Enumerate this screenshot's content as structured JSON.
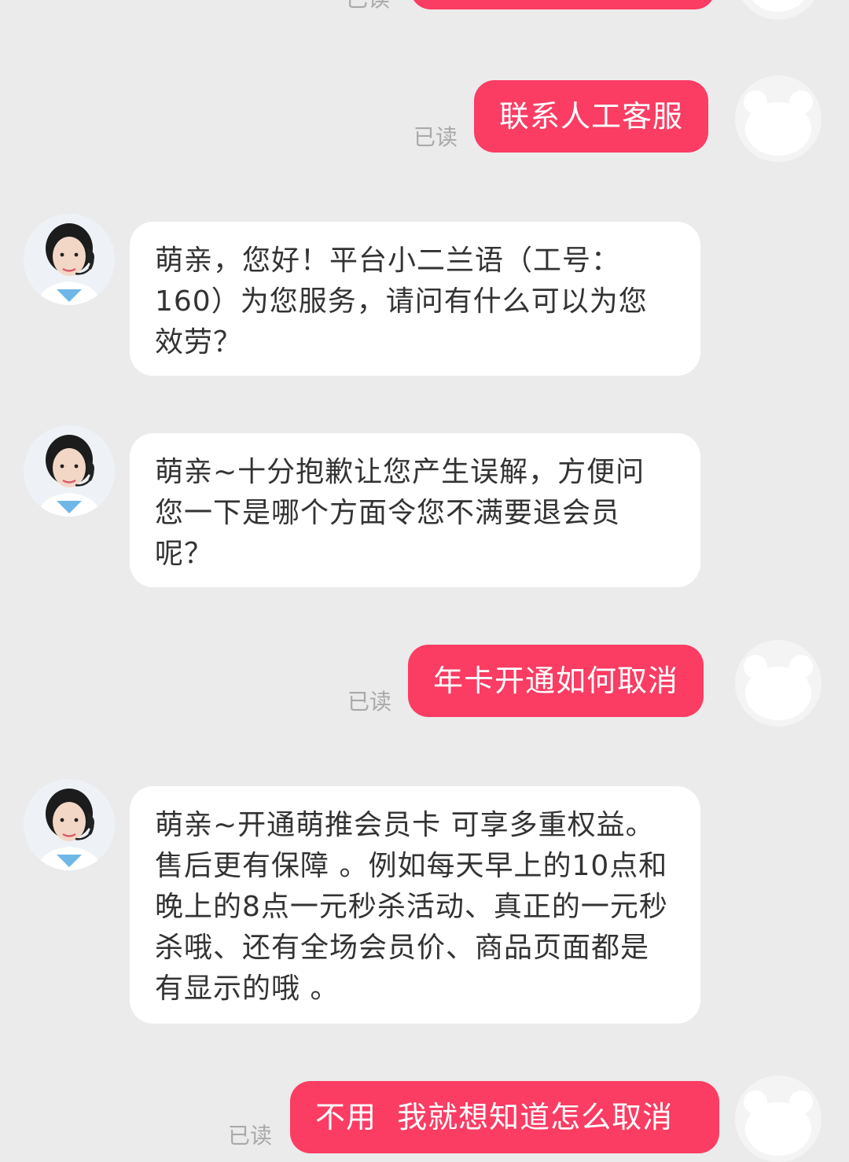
{
  "messages": [
    {
      "text": "联系人工客服",
      "status": "已读"
    },
    {
      "text": "萌亲，您好！平台小二兰语（工号：160）为您服务，请问有什么可以为您效劳？"
    },
    {
      "text": "萌亲~十分抱歉让您产生误解，方便问您一下是哪个方面令您不满要退会员呢？"
    },
    {
      "text": "年卡开通如何取消",
      "status": "已读"
    },
    {
      "text": "萌亲~开通萌推会员卡 可享多重权益。售后更有保障 。例如每天早上的10点和晚上的8点一元秒杀活动、真正的一元秒杀哦、还有全场会员价、商品页面都是有显示的哦 。"
    },
    {
      "text": "不用  我就想知道怎么取消",
      "status": "已读"
    }
  ],
  "top_partial": {
    "status": "已读"
  },
  "icons": {
    "user_avatar": "bear-silhouette-icon",
    "agent_avatar": "customer-service-agent-icon"
  },
  "colors": {
    "background": "#ebebeb",
    "outgoing_bubble": "#fb3c63",
    "incoming_bubble": "#ffffff",
    "read_status": "#a9a9a9"
  }
}
